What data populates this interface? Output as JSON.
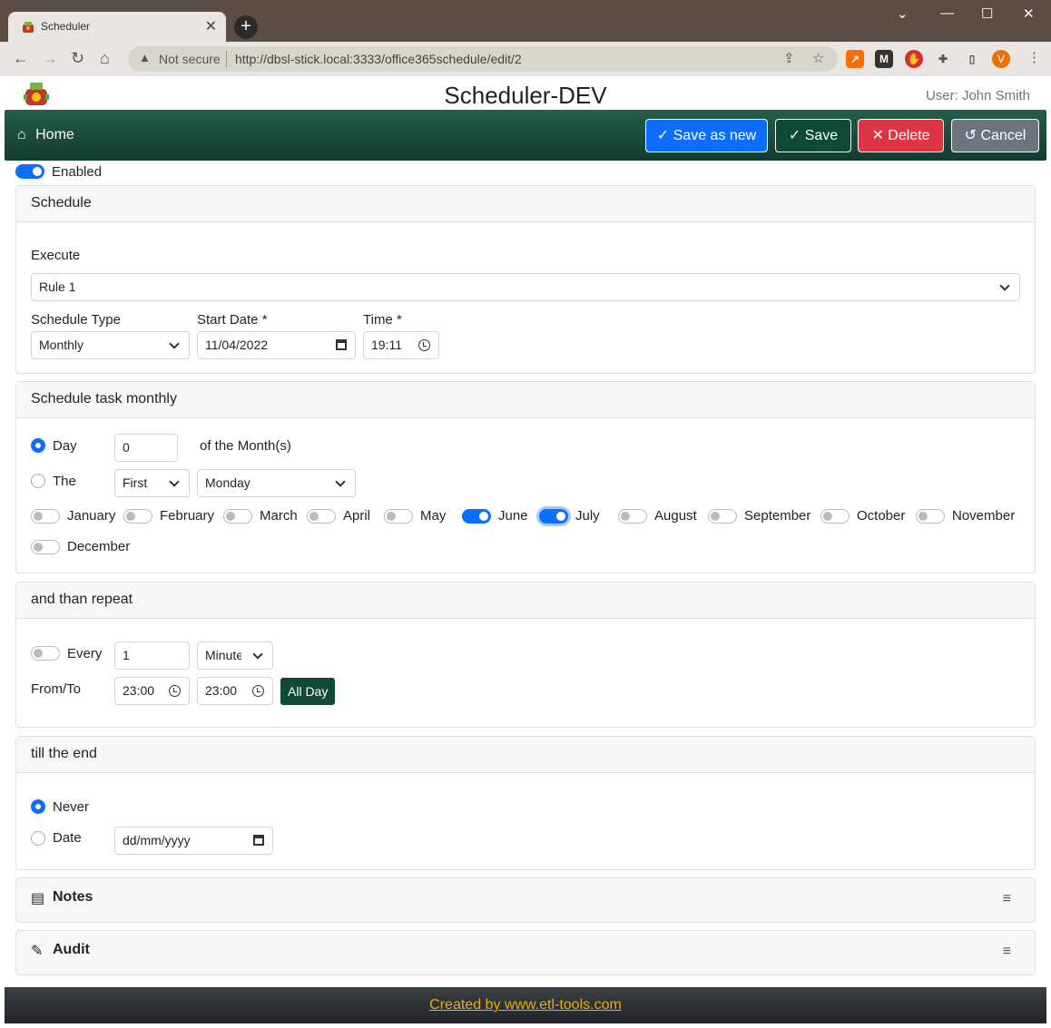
{
  "browser": {
    "tab_title": "Scheduler",
    "tab_close": "✕",
    "new_tab": "+",
    "not_secure": "Not secure",
    "url": "http://dbsl-stick.local:3333/office365schedule/edit/2",
    "avatar_letter": "V",
    "minimize": "⌄",
    "restore": "—",
    "maximize": "☐",
    "close": "✕"
  },
  "app": {
    "title": "Scheduler-DEV",
    "user": "User: John Smith"
  },
  "navbar": {
    "home": "Home",
    "save_as_new": "Save as new",
    "save": "Save",
    "delete": "Delete",
    "cancel": "Cancel"
  },
  "enabled": {
    "label": "Enabled",
    "on": true
  },
  "schedule": {
    "header": "Schedule",
    "execute_label": "Execute",
    "execute_value": "Rule 1",
    "type_label": "Schedule Type",
    "type_value": "Monthly",
    "start_date_label": "Start Date *",
    "start_date_value": "11/04/2022",
    "time_label": "Time *",
    "time_value": "19:11"
  },
  "monthly": {
    "header": "Schedule task monthly",
    "day_label": "Day",
    "day_value": "0",
    "of_month": "of the Month(s)",
    "the_label": "The",
    "ordinal_value": "First",
    "weekday_value": "Monday",
    "months": [
      {
        "name": "January",
        "on": false
      },
      {
        "name": "February",
        "on": false
      },
      {
        "name": "March",
        "on": false
      },
      {
        "name": "April",
        "on": false
      },
      {
        "name": "May",
        "on": false
      },
      {
        "name": "June",
        "on": true
      },
      {
        "name": "July",
        "on": true
      },
      {
        "name": "August",
        "on": false
      },
      {
        "name": "September",
        "on": false
      },
      {
        "name": "October",
        "on": false
      },
      {
        "name": "November",
        "on": false
      },
      {
        "name": "December",
        "on": false
      }
    ]
  },
  "repeat": {
    "header": "and than repeat",
    "every_label": "Every",
    "every_value": "1",
    "unit_value": "Minute",
    "from_to_label": "From/To",
    "from_value": "23:00",
    "to_value": "23:00",
    "all_day": "All Day"
  },
  "end": {
    "header": "till the end",
    "never_label": "Never",
    "date_label": "Date",
    "date_placeholder": "dd/mm/yyyy"
  },
  "notes": {
    "title": "Notes",
    "menu": "≡"
  },
  "audit": {
    "title": "Audit",
    "menu": "≡"
  },
  "footer": {
    "link": "Created by www.etl-tools.com"
  },
  "colors": {
    "primary": "#0d6efd",
    "navbar": "#1a4d3c",
    "danger": "#dc3545",
    "secondary": "#6c757d",
    "footer_link": "#f0ad00"
  }
}
